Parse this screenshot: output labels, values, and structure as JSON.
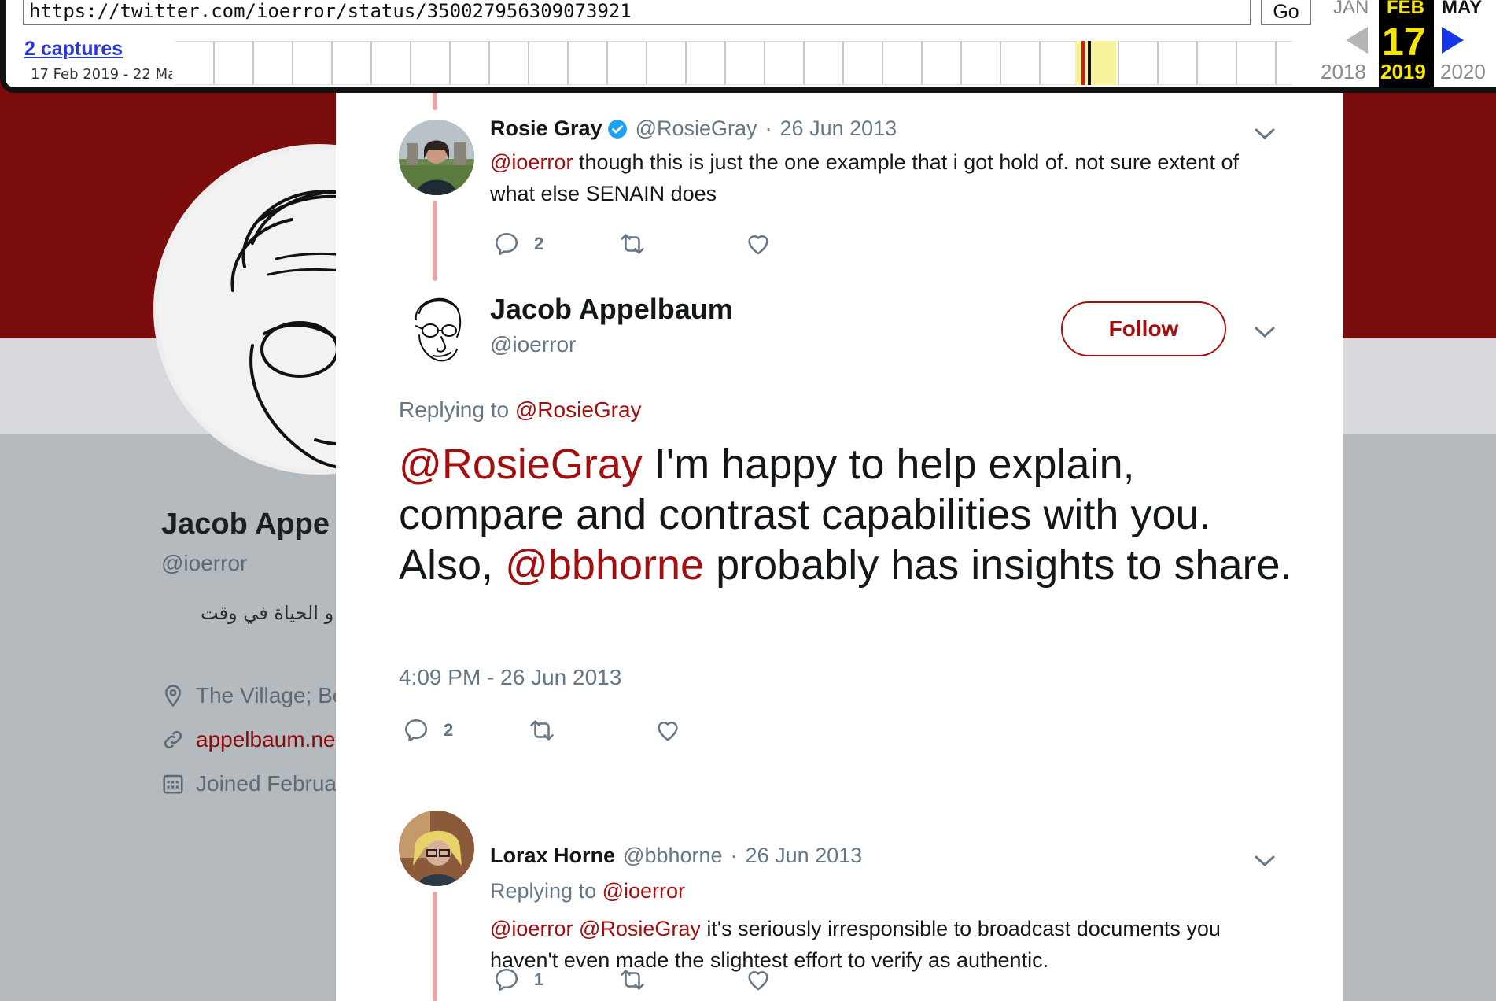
{
  "wayback": {
    "url": "https://twitter.com/ioerror/status/350027956309073921",
    "go_label": "Go",
    "captures_label": "2 captures",
    "date_range": "17 Feb 2019 - 22 Ma",
    "prev_month": "JAN",
    "current_month": "FEB",
    "next_month": "MAY",
    "current_day": "17",
    "prev_year": "2018",
    "current_year": "2019",
    "next_year": "2020"
  },
  "profile": {
    "name": "Jacob Appe",
    "handle": "@ioerror",
    "bio": "ب و الحياة في وقت",
    "location": "The Village; Be",
    "website": "appelbaum.ne",
    "joined": "Joined Februa"
  },
  "thread": {
    "reply1": {
      "name": "Rosie Gray",
      "handle": "@RosieGray",
      "separator": "·",
      "date": "26 Jun 2013",
      "mention": "@ioerror",
      "text": " though this is just the one example that i got hold of. not sure extent of what else SENAIN does",
      "reply_count": "2"
    },
    "main": {
      "name": "Jacob Appelbaum",
      "handle": "@ioerror",
      "follow_label": "Follow",
      "replying_prefix": "Replying to ",
      "replying_to": "@RosieGray",
      "mention1": "@RosieGray",
      "text_part1": " I'm happy to help explain, compare and contrast capabilities with you. Also, ",
      "mention2": "@bbhorne",
      "text_part2": " probably has insights to share.",
      "timestamp": "4:09 PM - 26 Jun 2013",
      "reply_count": "2"
    },
    "reply2": {
      "name": "Lorax Horne",
      "handle": "@bbhorne",
      "separator": "·",
      "date": "26 Jun 2013",
      "replying_prefix": "Replying to ",
      "replying_to": "@ioerror",
      "mention1": "@ioerror",
      "mention2": "@RosieGray",
      "text": " it's seriously irresponsible to broadcast documents you haven't even made the slightest effort to verify as authentic.",
      "reply_count": "1"
    }
  },
  "colors": {
    "accent": "#a50e0e",
    "header_bg": "#7a0c0c",
    "secondary_text": "#657786",
    "verified": "#1da1f2"
  },
  "icons": [
    "reply-icon",
    "retweet-icon",
    "like-icon",
    "chevron-down-icon",
    "verified-icon",
    "location-icon",
    "link-icon",
    "calendar-icon"
  ]
}
